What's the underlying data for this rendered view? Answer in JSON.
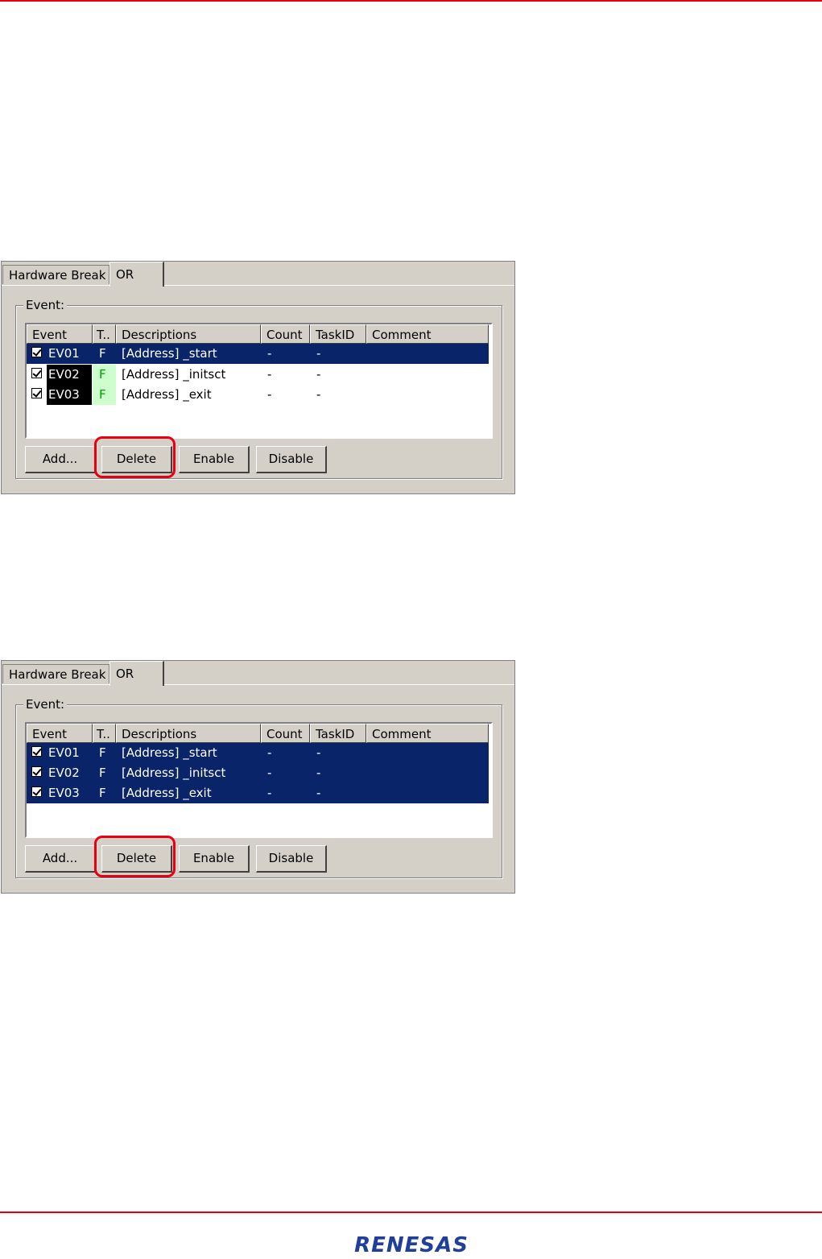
{
  "screens": [
    {
      "tabs": [
        "Hardware Break",
        "OR"
      ],
      "active_tab": "OR",
      "group_label": "Event:",
      "columns": [
        "Event",
        "T..",
        "Descriptions",
        "Count",
        "TaskID",
        "Comment"
      ],
      "rows": [
        {
          "checked": true,
          "event": "EV01",
          "type": "F",
          "description": "[Address] _start",
          "count": "-",
          "taskid": "-",
          "comment": "",
          "selected": true
        },
        {
          "checked": true,
          "event": "EV02",
          "type": "F",
          "description": "[Address] _initsct",
          "count": "-",
          "taskid": "-",
          "comment": "",
          "selected": false
        },
        {
          "checked": true,
          "event": "EV03",
          "type": "F",
          "description": "[Address] _exit",
          "count": "-",
          "taskid": "-",
          "comment": "",
          "selected": false
        }
      ],
      "buttons": [
        "Add...",
        "Delete",
        "Enable",
        "Disable"
      ],
      "highlighted_button": "Delete"
    },
    {
      "tabs": [
        "Hardware Break",
        "OR"
      ],
      "active_tab": "OR",
      "group_label": "Event:",
      "columns": [
        "Event",
        "T..",
        "Descriptions",
        "Count",
        "TaskID",
        "Comment"
      ],
      "rows": [
        {
          "checked": true,
          "event": "EV01",
          "type": "F",
          "description": "[Address] _start",
          "count": "-",
          "taskid": "-",
          "comment": "",
          "selected": true
        },
        {
          "checked": true,
          "event": "EV02",
          "type": "F",
          "description": "[Address] _initsct",
          "count": "-",
          "taskid": "-",
          "comment": "",
          "selected": true
        },
        {
          "checked": true,
          "event": "EV03",
          "type": "F",
          "description": "[Address] _exit",
          "count": "-",
          "taskid": "-",
          "comment": "",
          "selected": true
        }
      ],
      "buttons": [
        "Add...",
        "Delete",
        "Enable",
        "Disable"
      ],
      "highlighted_button": "Delete"
    }
  ],
  "footer": {
    "logo_text": "RENESAS"
  },
  "colors": {
    "accent_rule": "#e60012",
    "selection": "#0a246a",
    "logo": "#1f3f9a"
  }
}
